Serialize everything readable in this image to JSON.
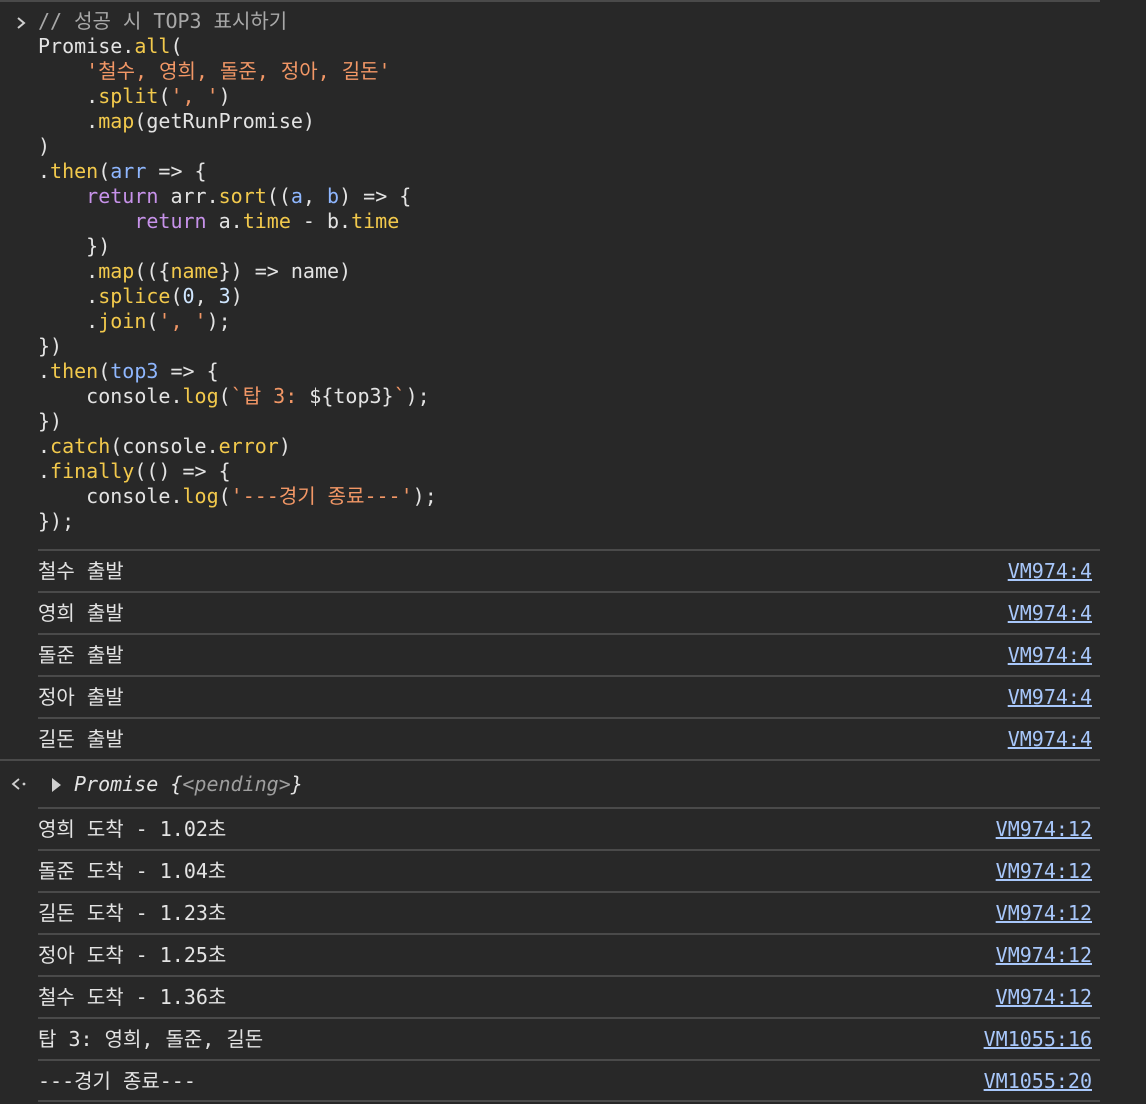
{
  "console": {
    "input_prompt_icon": "chevron-right-icon",
    "return_icon": "return-value-arrow-icon",
    "code_lines": [
      [
        {
          "t": "comment",
          "v": "// 성공 시 TOP3 표시하기"
        }
      ],
      [
        {
          "t": "plain",
          "v": "Promise."
        },
        {
          "t": "method",
          "v": "all"
        },
        {
          "t": "plain",
          "v": "("
        }
      ],
      [
        {
          "t": "plain",
          "v": "    "
        },
        {
          "t": "string",
          "v": "'철수, 영희, 돌준, 정아, 길돈'"
        }
      ],
      [
        {
          "t": "plain",
          "v": "    ."
        },
        {
          "t": "method",
          "v": "split"
        },
        {
          "t": "plain",
          "v": "("
        },
        {
          "t": "string",
          "v": "', '"
        },
        {
          "t": "plain",
          "v": ")"
        }
      ],
      [
        {
          "t": "plain",
          "v": "    ."
        },
        {
          "t": "method",
          "v": "map"
        },
        {
          "t": "plain",
          "v": "(getRunPromise)"
        }
      ],
      [
        {
          "t": "plain",
          "v": ")"
        }
      ],
      [
        {
          "t": "plain",
          "v": "."
        },
        {
          "t": "method",
          "v": "then"
        },
        {
          "t": "plain",
          "v": "("
        },
        {
          "t": "param",
          "v": "arr"
        },
        {
          "t": "plain",
          "v": " => {"
        }
      ],
      [
        {
          "t": "plain",
          "v": "    "
        },
        {
          "t": "keyword",
          "v": "return"
        },
        {
          "t": "plain",
          "v": " arr."
        },
        {
          "t": "method",
          "v": "sort"
        },
        {
          "t": "plain",
          "v": "(("
        },
        {
          "t": "param",
          "v": "a"
        },
        {
          "t": "plain",
          "v": ", "
        },
        {
          "t": "param",
          "v": "b"
        },
        {
          "t": "plain",
          "v": ") => {"
        }
      ],
      [
        {
          "t": "plain",
          "v": "        "
        },
        {
          "t": "keyword",
          "v": "return"
        },
        {
          "t": "plain",
          "v": " a."
        },
        {
          "t": "method",
          "v": "time"
        },
        {
          "t": "plain",
          "v": " - b."
        },
        {
          "t": "method",
          "v": "time"
        }
      ],
      [
        {
          "t": "plain",
          "v": "    })"
        }
      ],
      [
        {
          "t": "plain",
          "v": "    ."
        },
        {
          "t": "method",
          "v": "map"
        },
        {
          "t": "plain",
          "v": "(({"
        },
        {
          "t": "method",
          "v": "name"
        },
        {
          "t": "plain",
          "v": "}) => name)"
        }
      ],
      [
        {
          "t": "plain",
          "v": "    ."
        },
        {
          "t": "method",
          "v": "splice"
        },
        {
          "t": "plain",
          "v": "("
        },
        {
          "t": "number",
          "v": "0"
        },
        {
          "t": "plain",
          "v": ", "
        },
        {
          "t": "number",
          "v": "3"
        },
        {
          "t": "plain",
          "v": ")"
        }
      ],
      [
        {
          "t": "plain",
          "v": "    ."
        },
        {
          "t": "method",
          "v": "join"
        },
        {
          "t": "plain",
          "v": "("
        },
        {
          "t": "string",
          "v": "', '"
        },
        {
          "t": "plain",
          "v": ");"
        }
      ],
      [
        {
          "t": "plain",
          "v": "})"
        }
      ],
      [
        {
          "t": "plain",
          "v": "."
        },
        {
          "t": "method",
          "v": "then"
        },
        {
          "t": "plain",
          "v": "("
        },
        {
          "t": "param",
          "v": "top3"
        },
        {
          "t": "plain",
          "v": " => {"
        }
      ],
      [
        {
          "t": "plain",
          "v": "    console."
        },
        {
          "t": "method",
          "v": "log"
        },
        {
          "t": "plain",
          "v": "("
        },
        {
          "t": "string",
          "v": "`탑 3: "
        },
        {
          "t": "plain",
          "v": "${top3}"
        },
        {
          "t": "string",
          "v": "`"
        },
        {
          "t": "plain",
          "v": ");"
        }
      ],
      [
        {
          "t": "plain",
          "v": "})"
        }
      ],
      [
        {
          "t": "plain",
          "v": "."
        },
        {
          "t": "method",
          "v": "catch"
        },
        {
          "t": "plain",
          "v": "(console."
        },
        {
          "t": "method",
          "v": "error"
        },
        {
          "t": "plain",
          "v": ")"
        }
      ],
      [
        {
          "t": "plain",
          "v": "."
        },
        {
          "t": "method",
          "v": "finally"
        },
        {
          "t": "plain",
          "v": "(() => {"
        }
      ],
      [
        {
          "t": "plain",
          "v": "    console."
        },
        {
          "t": "method",
          "v": "log"
        },
        {
          "t": "plain",
          "v": "("
        },
        {
          "t": "string",
          "v": "'---경기 종료---'"
        },
        {
          "t": "plain",
          "v": ");"
        }
      ],
      [
        {
          "t": "plain",
          "v": "});"
        }
      ]
    ],
    "start_logs": [
      {
        "text": "철수 출발",
        "source": "VM974:4"
      },
      {
        "text": "영희 출발",
        "source": "VM974:4"
      },
      {
        "text": "돌준 출발",
        "source": "VM974:4"
      },
      {
        "text": "정아 출발",
        "source": "VM974:4"
      },
      {
        "text": "길돈 출발",
        "source": "VM974:4"
      }
    ],
    "return_value": {
      "label": "Promise ",
      "open_brace": "{",
      "state": "<pending>",
      "close_brace": "}"
    },
    "finish_logs": [
      {
        "text": "영희 도착 - 1.02초",
        "source": "VM974:12"
      },
      {
        "text": "돌준 도착 - 1.04초",
        "source": "VM974:12"
      },
      {
        "text": "길돈 도착 - 1.23초",
        "source": "VM974:12"
      },
      {
        "text": "정아 도착 - 1.25초",
        "source": "VM974:12"
      },
      {
        "text": "철수 도착 - 1.36초",
        "source": "VM974:12"
      },
      {
        "text": "탑 3: 영희, 돌준, 길돈",
        "source": "VM1055:16"
      },
      {
        "text": "---경기 종료---",
        "source": "VM1055:20"
      }
    ]
  }
}
